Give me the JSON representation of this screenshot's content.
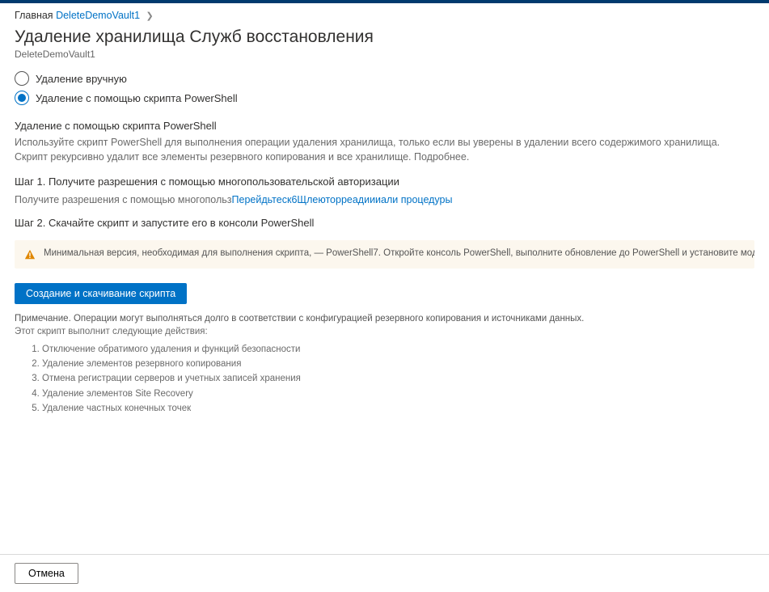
{
  "breadcrumb": {
    "home": "Главная",
    "current": "DeleteDemoVault1"
  },
  "page": {
    "title": "Удаление хранилища Служб восстановления",
    "subtitle": "DeleteDemoVault1"
  },
  "options": {
    "manual": "Удаление вручную",
    "powershell": "Удаление с помощью скрипта PowerShell"
  },
  "section": {
    "heading": "Удаление с помощью скрипта PowerShell",
    "description": "Используйте скрипт PowerShell для выполнения операции удаления хранилища, только если вы уверены в удалении всего содержимого хранилища. Скрипт рекурсивно удалит все элементы резервного копирования и все хранилище. Подробнее."
  },
  "step1": {
    "title": "Шаг 1. Получите разрешения с помощью многопользовательской авторизации",
    "prefix": "Получите разрешения с помощью многопольз",
    "link_mid": "Перейдьтеск6Щлеюторреадиии",
    "link_end": "али процедуры"
  },
  "step2": {
    "title": "Шаг 2. Скачайте скрипт и запустите его в консоли PowerShell"
  },
  "alert": {
    "text": "Минимальная версия, необходимая для выполнения скрипта, — PowerShell7. Откройте консоль PowerShell, выполните обновление до PowerShell и установите модуль Az, запустив команды, указанные"
  },
  "button": {
    "generate": "Создание и скачивание скрипта"
  },
  "notes": {
    "line1": "Примечание. Операции могут выполняться долго в соответствии с конфигурацией резервного копирования и источниками данных.",
    "line2": "Этот скрипт выполнит следующие действия:"
  },
  "actions": [
    "Отключение обратимого удаления и функций безопасности",
    "Удаление элементов резервного копирования",
    "Отмена регистрации серверов и учетных записей хранения",
    "Удаление элементов Site Recovery",
    "Удаление частных конечных точек"
  ],
  "footer": {
    "cancel": "Отмена"
  }
}
